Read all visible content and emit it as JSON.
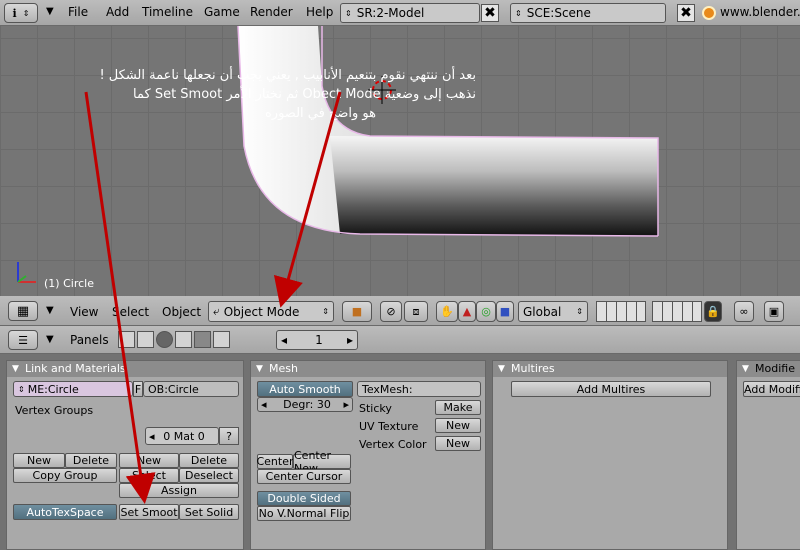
{
  "topbar": {
    "menus": [
      "File",
      "Add",
      "Timeline",
      "Game",
      "Render",
      "Help"
    ],
    "screen_field": "SR:2-Model",
    "scene_field": "SCE:Scene",
    "site_label": "www.blender.org 2",
    "close_glyph": "✖"
  },
  "viewport": {
    "object_label": "(1) Circle",
    "annotation_lines": [
      "بعد أن ننتهي نقوم بتنعيم الأنابيب , يعني يجب أن نجعلها ناعمة الشكل !",
      "نذهب إلى وضعية Obect Mode ثم نختار الأمر Set Smoot كما",
      "هو واضح في الصوره"
    ]
  },
  "viewbar": {
    "view_label": "View",
    "select_label": "Select",
    "object_label": "Object",
    "mode_label": "Object Mode",
    "orientation_label": "Global"
  },
  "panelbar": {
    "panels_label": "Panels",
    "frame_value": "1"
  },
  "link_materials": {
    "title": "Link and Materials",
    "mesh_name": "ME:Circle",
    "f_label": "F",
    "object_name": "OB:Circle",
    "vertex_groups_label": "Vertex Groups",
    "mat_label": "0 Mat 0",
    "mat_q": "?",
    "new_label": "New",
    "delete_label": "Delete",
    "copy_group_label": "Copy Group",
    "new2_label": "New",
    "delete2_label": "Delete",
    "select_label": "Select",
    "deselect_label": "Deselect",
    "assign_label": "Assign",
    "autotexspace_label": "AutoTexSpace",
    "set_smooth_label": "Set Smoot",
    "set_solid_label": "Set Solid"
  },
  "mesh": {
    "title": "Mesh",
    "auto_smooth_label": "Auto Smooth",
    "degr_label": "Degr: 30",
    "texmesh_label": "TexMesh:",
    "sticky_label": "Sticky",
    "make_label": "Make",
    "uv_texture_label": "UV Texture",
    "new_label": "New",
    "vertex_color_label": "Vertex Color",
    "new2_label": "New",
    "center_label": "Center",
    "center_new_label": "Center New",
    "center_cursor_label": "Center Cursor",
    "double_sided_label": "Double Sided",
    "no_vnormal_label": "No V.Normal Flip"
  },
  "multires": {
    "title": "Multires",
    "add_label": "Add Multires"
  },
  "modifiers": {
    "title": "Modifie",
    "add_label": "Add Modifie"
  },
  "colors": {
    "annotation_arrow": "#c00000",
    "dark_button": "#5c7a8a"
  }
}
